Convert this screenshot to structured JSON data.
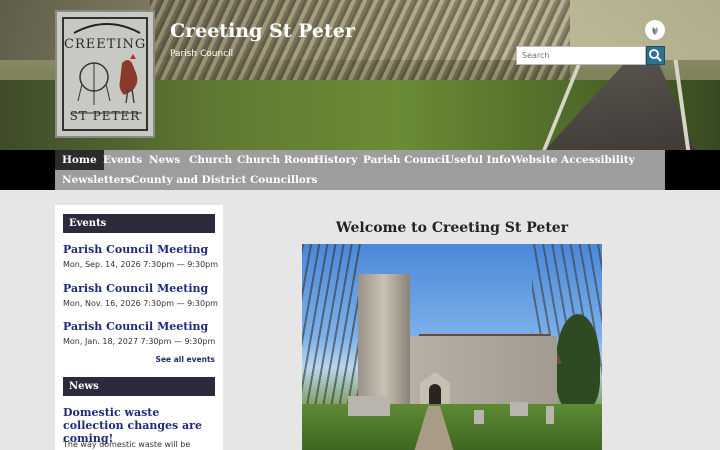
{
  "header": {
    "title": "Creeting St Peter",
    "subtitle": "Parish Council",
    "logo_text_top": "CREETING",
    "logo_text_bottom": "ST PETER",
    "search_placeholder": "Search"
  },
  "nav": {
    "items": [
      {
        "label": "Home",
        "active": true
      },
      {
        "label": "Events"
      },
      {
        "label": "News"
      },
      {
        "label": "Church"
      },
      {
        "label": "Church Room"
      },
      {
        "label": "History"
      },
      {
        "label": "Parish Council"
      },
      {
        "label": "Useful Info"
      },
      {
        "label": "Website Accessibility"
      },
      {
        "label": "Newsletters"
      },
      {
        "label": "County and District Councillors"
      }
    ]
  },
  "sidebar": {
    "events_heading": "Events",
    "events": [
      {
        "title": "Parish Council Meeting",
        "date": "Mon, Sep. 14, 2026 7:30pm — 9:30pm"
      },
      {
        "title": "Parish Council Meeting",
        "date": "Mon, Nov. 16, 2026 7:30pm — 9:30pm"
      },
      {
        "title": "Parish Council Meeting",
        "date": "Mon, Jan. 18, 2027 7:30pm — 9:30pm"
      }
    ],
    "see_all": "See all events",
    "news_heading": "News",
    "news_title": "Domestic waste collection changes are coming!",
    "news_text": "The way domestic waste will be"
  },
  "main": {
    "welcome": "Welcome to Creeting St Peter"
  },
  "colors": {
    "nav_bg": "#9d9d9d",
    "nav_active": "#2b2b2b",
    "widget_head": "#2e2a3c",
    "link_blue": "#1f2a7a"
  },
  "icons": {
    "search": "search-icon",
    "accessibility": "leaf-icon"
  }
}
